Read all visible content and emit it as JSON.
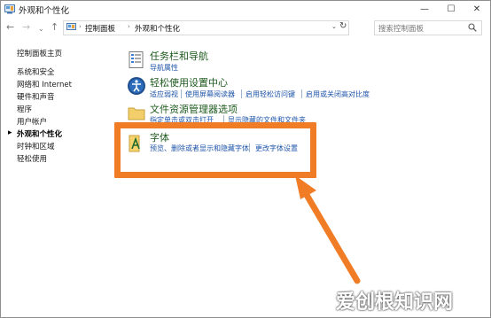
{
  "window": {
    "title": "外观和个性化",
    "controls": {
      "minimize": "—",
      "maximize": "☐",
      "close": "✕"
    }
  },
  "nav": {
    "back": "←",
    "forward": "→",
    "recent": "⌄",
    "up": "↑"
  },
  "address": {
    "crumbs": [
      "控制面板",
      "外观和个性化"
    ],
    "separator": "›",
    "refresh": "↻"
  },
  "search": {
    "placeholder": "搜索控制面板"
  },
  "sidebar": {
    "items": [
      {
        "label": "控制面板主页"
      },
      {
        "label": "系统和安全"
      },
      {
        "label": "网络和 Internet"
      },
      {
        "label": "硬件和声音"
      },
      {
        "label": "程序"
      },
      {
        "label": "用户帐户"
      },
      {
        "label": "外观和个性化",
        "active": true
      },
      {
        "label": "时钟和区域"
      },
      {
        "label": "轻松使用"
      }
    ],
    "active_marker": "▸"
  },
  "categories": [
    {
      "title": "任务栏和导航",
      "links": [
        "导航属性"
      ],
      "icon": "taskbar-icon"
    },
    {
      "title": "轻松使用设置中心",
      "links": [
        "适应弱视",
        "使用屏幕阅读器",
        "启用轻松访问键",
        "启用或关闭高对比度"
      ],
      "icon": "ease-of-access-icon"
    },
    {
      "title": "文件资源管理器选项",
      "links": [
        "指定单击或双击打开",
        "显示隐藏的文件和文件夹"
      ],
      "icon": "folder-options-icon"
    },
    {
      "title": "字体",
      "links": [
        "预览、删除或者显示和隐藏字体",
        "更改字体设置"
      ],
      "icon": "fonts-icon"
    }
  ],
  "watermark": {
    "text": "爱创根知识网"
  },
  "colors": {
    "highlight": "#f07c26",
    "link": "#1f55a8",
    "category_title": "#1e5a1e"
  }
}
